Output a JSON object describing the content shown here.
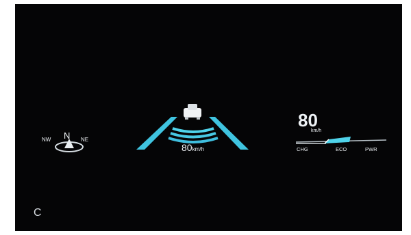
{
  "compass": {
    "heading": "N",
    "left": "NW",
    "right": "NE",
    "icon": "compass-arrow-icon"
  },
  "cruise": {
    "set_speed": "80",
    "unit": "km/h",
    "icon": "lead-car-icon"
  },
  "speedometer": {
    "speed": "80",
    "unit": "km/h"
  },
  "power_meter": {
    "labels": [
      "CHG",
      "ECO",
      "PWR"
    ],
    "level": 0.45,
    "accent": "#4fd3ea"
  },
  "corner_label": "C",
  "colors": {
    "background": "#050506",
    "lane": "#3fc4e0",
    "text": "#eef2f5"
  }
}
